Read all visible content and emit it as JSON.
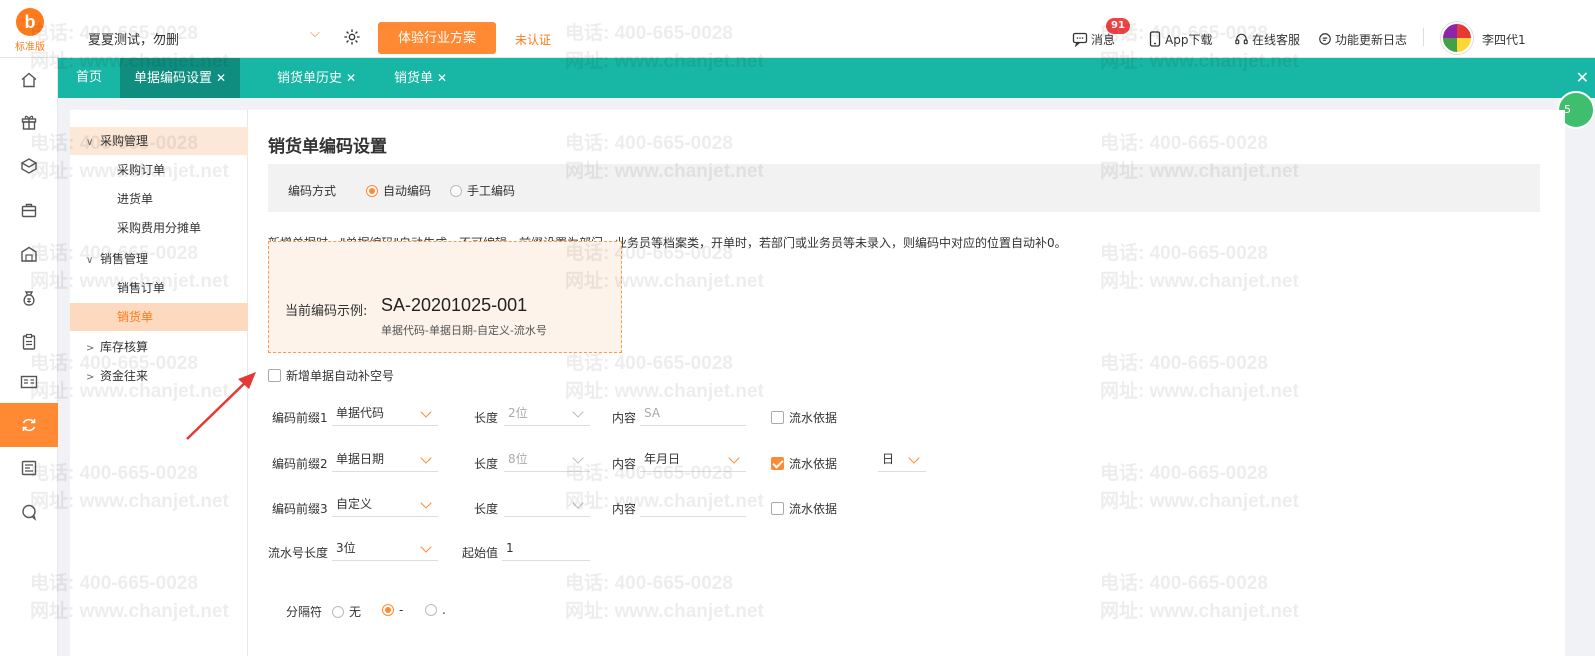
{
  "topbar": {
    "logo_text": "标准版",
    "company": "夏夏测试，勿删",
    "trial_button": "体验行业方案",
    "unverified": "未认证",
    "messages_label": "消息",
    "messages_badge": "91",
    "app_download": "App下载",
    "online_service": "在线客服",
    "changelog": "功能更新日志",
    "username": "李四代1"
  },
  "rail_icons": [
    "home-icon",
    "gift-icon",
    "box-icon",
    "bag-icon",
    "warehouse-icon",
    "money-bag-icon",
    "clipboard-icon",
    "id-card-icon",
    "sync-icon",
    "news-icon",
    "chat-icon"
  ],
  "tabs": [
    {
      "label": "首页",
      "closable": false
    },
    {
      "label": "单据编码设置",
      "closable": true
    },
    {
      "label": "销货单历史",
      "closable": true
    },
    {
      "label": "销货单",
      "closable": true
    }
  ],
  "float_ball_text": "5",
  "tree": {
    "purchase": {
      "label": "采购管理",
      "items": [
        "采购订单",
        "进货单",
        "采购费用分摊单"
      ]
    },
    "sales": {
      "label": "销售管理",
      "items": [
        "销售订单",
        "销货单"
      ]
    },
    "inventory": {
      "label": "库存核算"
    },
    "funds": {
      "label": "资金往来"
    }
  },
  "main": {
    "title": "销货单编码设置",
    "mode_label": "编码方式",
    "mode_auto": "自动编码",
    "mode_manual": "手工编码",
    "description": "新增单据时，\"单据编码\"自动生成，不可编辑。前缀设置为部门、业务员等档案类，开单时，若部门或业务员等未录入，则编码中对应的位置自动补0。",
    "example_label": "当前编码示例:",
    "example_code": "SA-20201025-001",
    "example_format": "单据代码-单据日期-自定义-流水号",
    "autofill_label": "新增单据自动补空号",
    "prefix_rows": [
      {
        "label": "编码前缀1",
        "type": "单据代码",
        "length_label": "长度",
        "length": "2位",
        "content_label": "内容",
        "content": "SA",
        "serial_label": "流水依据",
        "serial_checked": false,
        "period": ""
      },
      {
        "label": "编码前缀2",
        "type": "单据日期",
        "length_label": "长度",
        "length": "8位",
        "content_label": "内容",
        "content": "年月日",
        "serial_label": "流水依据",
        "serial_checked": true,
        "period": "日"
      },
      {
        "label": "编码前缀3",
        "type": "自定义",
        "length_label": "长度",
        "length": "",
        "content_label": "内容",
        "content": "",
        "serial_label": "流水依据",
        "serial_checked": false,
        "period": ""
      }
    ],
    "serial_length_label": "流水号长度",
    "serial_length": "3位",
    "start_label": "起始值",
    "start_value": "1",
    "separator_label": "分隔符",
    "separator_options": [
      "无",
      "-",
      "."
    ],
    "separator_selected": 1
  },
  "watermark": {
    "phone": "电话: 400-665-0028",
    "site": "网址: www.chanjet.net"
  },
  "colors": {
    "accent": "#ff8a33",
    "tabbar": "#18b6a4",
    "tab_active": "#0f8e80",
    "selected_bg": "#fdd9bf"
  }
}
